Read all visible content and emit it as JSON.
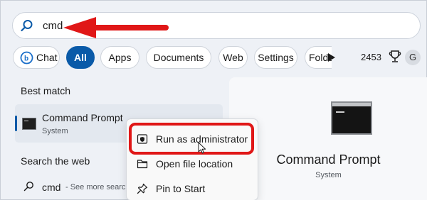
{
  "search": {
    "query": "cmd"
  },
  "filters": {
    "chat": "Chat",
    "all": "All",
    "apps": "Apps",
    "documents": "Documents",
    "web": "Web",
    "settings": "Settings",
    "folders": "Folde",
    "points": "2453",
    "avatar_initial": "G"
  },
  "results": {
    "best_match_label": "Best match",
    "best_match": {
      "title": "Command Prompt",
      "subtitle": "System"
    },
    "search_web_label": "Search the web",
    "web_item": {
      "term": "cmd",
      "hint": "- See more search"
    }
  },
  "context_menu": {
    "items": [
      {
        "label": "Run as administrator",
        "icon": "shield-icon"
      },
      {
        "label": "Open file location",
        "icon": "folder-icon"
      },
      {
        "label": "Pin to Start",
        "icon": "pin-icon"
      }
    ]
  },
  "preview": {
    "title": "Command Prompt",
    "subtitle": "System"
  },
  "colors": {
    "accent": "#0a5aa8",
    "annotation_red": "#e01717"
  }
}
